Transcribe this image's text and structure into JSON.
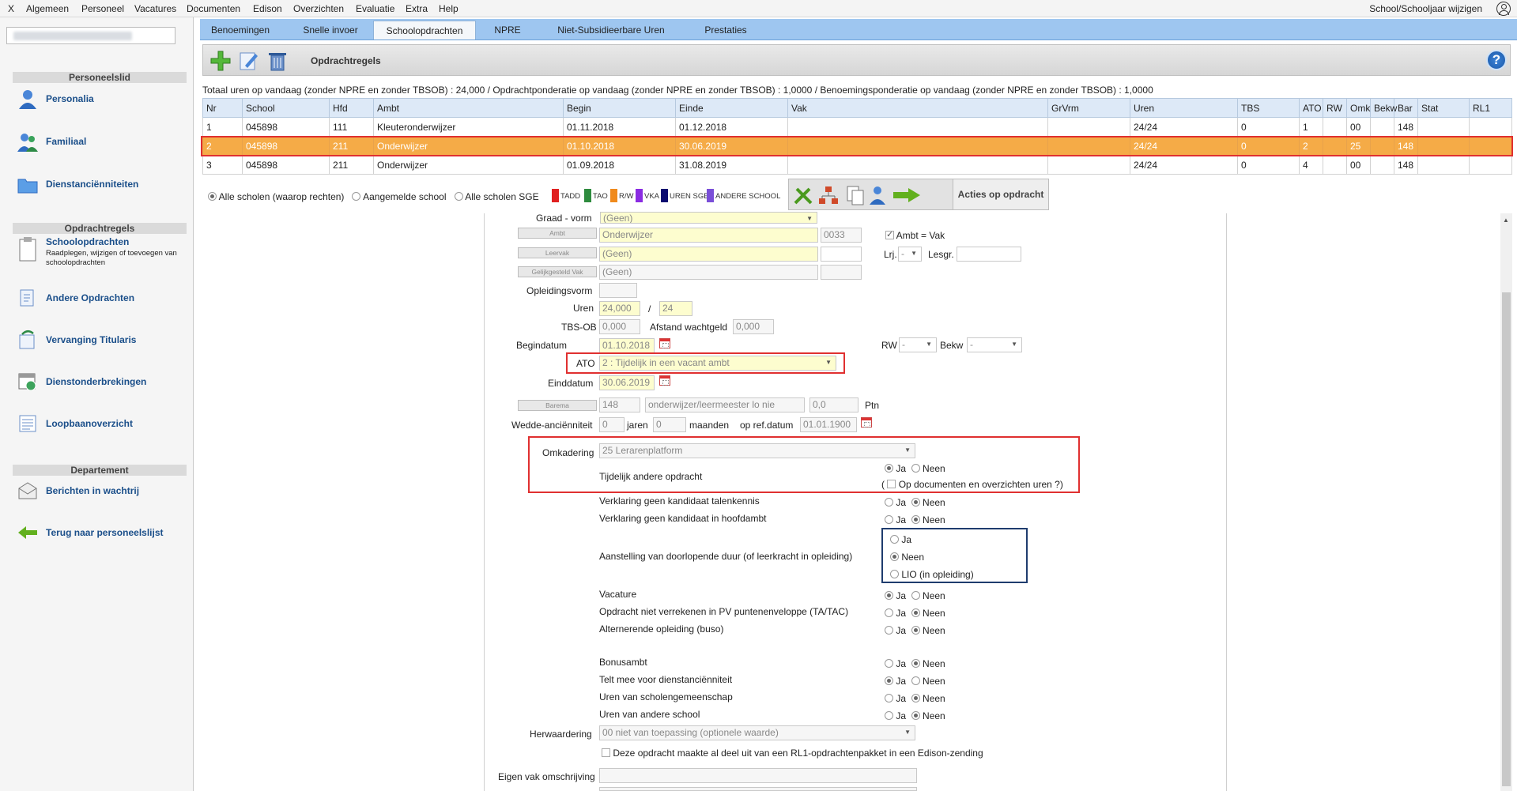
{
  "menu": {
    "items": [
      "X",
      "Algemeen",
      "Personeel",
      "Vacatures",
      "Documenten",
      "Edison",
      "Overzichten",
      "Evaluatie",
      "Extra",
      "Help"
    ],
    "right": "School/Schooljaar wijzigen"
  },
  "sidebar": {
    "sections": [
      "Personeelslid",
      "Opdrachtregels",
      "Departement"
    ],
    "items": [
      "Personalia",
      "Familiaal",
      "Dienstanciënniteiten",
      "Schoolopdrachten",
      "Andere Opdrachten",
      "Vervanging Titularis",
      "Dienstonderbrekingen",
      "Loopbaanoverzicht",
      "Berichten in wachtrij",
      "Terug naar personeelslijst"
    ],
    "schoolopdrachten_sub": "Raadplegen, wijzigen of toevoegen van schoolopdrachten"
  },
  "tabs": [
    "Benoemingen",
    "Snelle invoer",
    "Schoolopdrachten",
    "NPRE",
    "Niet-Subsidieerbare Uren",
    "Prestaties"
  ],
  "toolbar": {
    "title": "Opdrachtregels",
    "help": "?"
  },
  "summary": "Totaal uren op vandaag (zonder NPRE en zonder TBSOB) : 24,000 / Opdrachtponderatie op vandaag (zonder NPRE en zonder TBSOB) : 1,0000 / Benoemingsponderatie op vandaag (zonder NPRE en zonder TBSOB) : 1,0000",
  "table": {
    "headers": [
      "Nr",
      "School",
      "Hfd",
      "Ambt",
      "Begin",
      "Einde",
      "Vak",
      "GrVrm",
      "Uren",
      "TBS",
      "ATO",
      "RW",
      "Omk",
      "Bekw",
      "Bar",
      "Stat",
      "RL1"
    ],
    "rows": [
      [
        "1",
        "045898",
        "111",
        "Kleuteronderwijzer",
        "01.11.2018",
        "01.12.2018",
        "",
        "",
        "24/24",
        "0",
        "1",
        "",
        "00",
        "",
        "148",
        "",
        ""
      ],
      [
        "2",
        "045898",
        "211",
        "Onderwijzer",
        "01.10.2018",
        "30.06.2019",
        "",
        "",
        "24/24",
        "0",
        "2",
        "",
        "25",
        "",
        "148",
        "",
        ""
      ],
      [
        "3",
        "045898",
        "211",
        "Onderwijzer",
        "01.09.2018",
        "31.08.2019",
        "",
        "",
        "24/24",
        "0",
        "4",
        "",
        "00",
        "",
        "148",
        "",
        ""
      ]
    ],
    "selected_row": 2
  },
  "filters": {
    "opt1": "Alle scholen (waarop rechten)",
    "opt2": "Aangemelde school",
    "opt3": "Alle scholen SGE"
  },
  "legend": [
    {
      "label": "TADD",
      "color": "#e02020"
    },
    {
      "label": "TAO",
      "color": "#2e8b3e"
    },
    {
      "label": "R/W",
      "color": "#f08a1c"
    },
    {
      "label": "VKA",
      "color": "#8a2be2"
    },
    {
      "label": "UREN SGE",
      "color": "#0a0a70"
    },
    {
      "label": "ANDERE SCHOOL",
      "color": "#7a4fd8"
    }
  ],
  "actions": {
    "label": "Acties op opdracht"
  },
  "form": {
    "graad_label": "Graad - vorm",
    "graad_value": "(Geen)",
    "ambt_btn": "Ambt",
    "ambt_value": "Onderwijzer",
    "ambt_code": "0033",
    "ambt_vak": "Ambt = Vak",
    "leervak_btn": "Leervak",
    "leervak_value": "(Geen)",
    "lrj_label": "Lrj.",
    "lrj_value": "-",
    "lesgr_label": "Lesgr.",
    "gelijk_btn": "Gelijkgesteld Vak",
    "gelijk_value": "(Geen)",
    "opleidingsvorm_label": "Opleidingsvorm",
    "uren_label": "Uren",
    "uren_value": "24,000",
    "uren_sep": "/",
    "uren_total": "24",
    "tbs_label": "TBS-OB",
    "tbs_value": "0,000",
    "afstand_label": "Afstand wachtgeld",
    "afstand_value": "0,000",
    "begin_label": "Begindatum",
    "begin_value": "01.10.2018",
    "rw_label": "RW",
    "rw_value": "-",
    "bekw_label": "Bekw",
    "bekw_value": "-",
    "ato_label": "ATO",
    "ato_value": "2 : Tijdelijk in een vacant ambt",
    "eind_label": "Einddatum",
    "eind_value": "30.06.2019",
    "barema_btn": "Barema",
    "barema_value": "148",
    "barema_desc": "onderwijzer/leermeester lo nie",
    "barema_ptn": "0,0",
    "ptn_label": "Ptn",
    "wedde_label": "Wedde-anciënniteit",
    "wedde_jaren": "0",
    "jaren_label": "jaren",
    "wedde_maanden": "0",
    "maanden_label": "maanden",
    "refdatum_label": "op ref.datum",
    "refdatum_value": "01.01.1900",
    "omk_label": "Omkadering",
    "omk_value": "25 Lerarenplatform",
    "tijdelijk_label": "Tijdelijk andere opdracht",
    "op_documenten": "Op documenten en overzichten uren ?)",
    "op_documenten_paren": "(",
    "talenkennis_label": "Verklaring geen kandidaat talenkennis",
    "hoofdambt_label": "Verklaring geen kandidaat in hoofdambt",
    "aanstelling_label": "Aanstelling van doorlopende duur (of leerkracht in opleiding)",
    "aanstelling_opts": [
      "Ja",
      "Neen",
      "LIO (in opleiding)"
    ],
    "vacature_label": "Vacature",
    "niet_verrekenen_label": "Opdracht niet verrekenen in PV puntenenveloppe (TA/TAC)",
    "alternerende_label": "Alternerende opleiding (buso)",
    "bonusambt_label": "Bonusambt",
    "telt_mee_label": "Telt mee voor dienstanciënniteit",
    "uren_sg_label": "Uren van scholengemeenschap",
    "uren_andere_label": "Uren van andere school",
    "herwaardering_label": "Herwaardering",
    "herwaardering_value": "00 niet van toepassing (optionele waarde)",
    "rl1_label": "Deze opdracht maakte al deel uit van een RL1-opdrachtenpakket in een Edison-zending",
    "eigen_vak_label": "Eigen vak omschrijving",
    "ja": "Ja",
    "neen": "Neen"
  }
}
